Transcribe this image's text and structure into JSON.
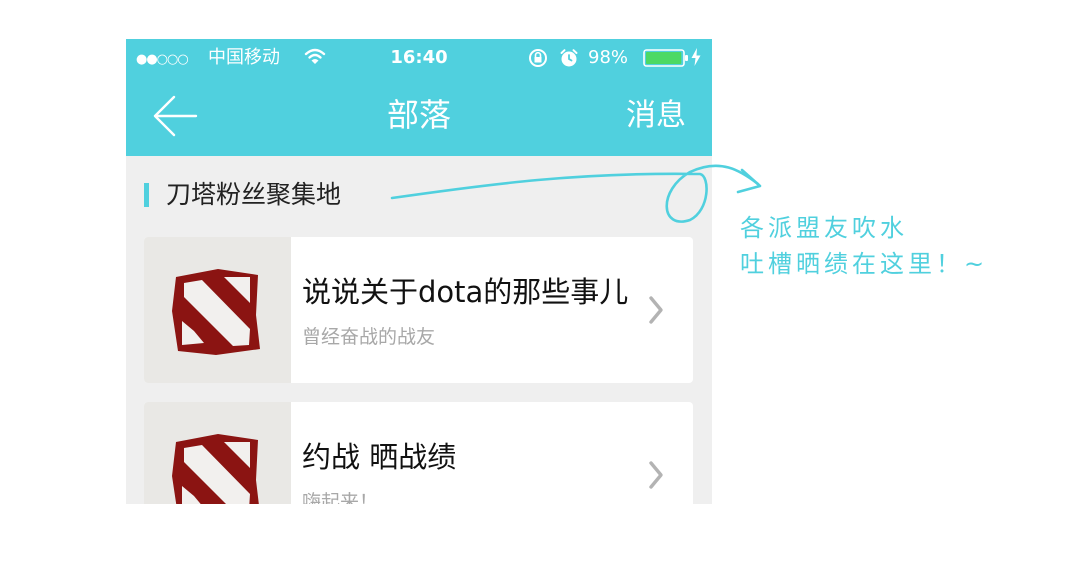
{
  "status_bar": {
    "carrier_dots": "●●○○○",
    "carrier": "中国移动",
    "time": "16:40",
    "battery_percent": "98%",
    "battery_level": 0.98
  },
  "nav": {
    "back_icon": "back-arrow-icon",
    "title": "部落",
    "messages": "消息"
  },
  "section": {
    "title": "刀塔粉丝聚集地"
  },
  "cards": [
    {
      "title": "说说关于dota的那些事儿",
      "subtitle": "曾经奋战的战友",
      "icon": "dota-logo-icon"
    },
    {
      "title": "约战  晒战绩",
      "subtitle": "嗨起来！",
      "icon": "dota-logo-icon"
    }
  ],
  "annotation": {
    "line1": "各派盟友吹水",
    "line2": "吐槽晒绩在这里！~"
  },
  "colors": {
    "accent": "#50d0de",
    "background": "#efefef",
    "logo_red": "#8b1412"
  }
}
